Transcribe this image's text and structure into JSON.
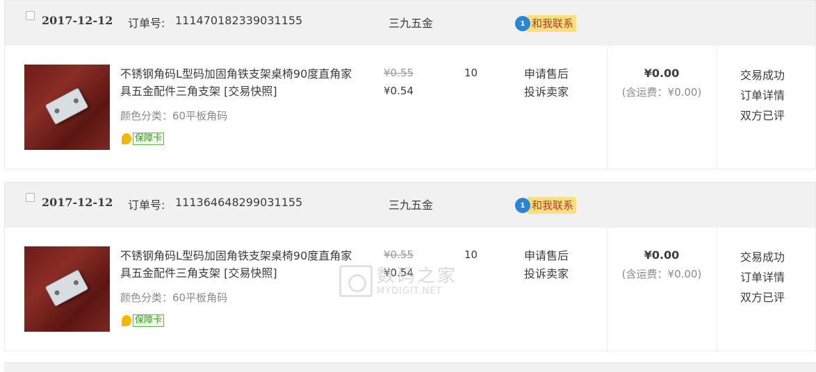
{
  "orders": [
    {
      "date": "2017-12-12",
      "order_no_label": "订单号:",
      "order_no": "111470182339031155",
      "shop": "三九五金",
      "contact_badge": "1",
      "contact_label": "和我联系",
      "item": {
        "title": "不锈钢角码L型码加固角铁支架桌椅90度直角家具五金配件三角支架 [交易快照]",
        "variant": "颜色分类：60平板角码",
        "guarantee": "保障卡",
        "price_original": "¥0.55",
        "price_current": "¥0.54",
        "quantity": "10",
        "after_sale": "申请售后",
        "complain": "投诉卖家"
      },
      "total": "¥0.00",
      "shipping": "(含运费：¥0.00)",
      "status": "交易成功",
      "detail_link": "订单详情",
      "review_status": "双方已评"
    },
    {
      "date": "2017-12-12",
      "order_no_label": "订单号:",
      "order_no": "111364648299031155",
      "shop": "三九五金",
      "contact_badge": "1",
      "contact_label": "和我联系",
      "item": {
        "title": "不锈钢角码L型码加固角铁支架桌椅90度直角家具五金配件三角支架 [交易快照]",
        "variant": "颜色分类：60平板角码",
        "guarantee": "保障卡",
        "price_original": "¥0.55",
        "price_current": "¥0.54",
        "quantity": "10",
        "after_sale": "申请售后",
        "complain": "投诉卖家"
      },
      "total": "¥0.00",
      "shipping": "(含运费：¥0.00)",
      "status": "交易成功",
      "detail_link": "订单详情",
      "review_status": "双方已评"
    }
  ],
  "watermark": {
    "cn": "数码之家",
    "en": "MYDIGIT.NET"
  },
  "colors": {
    "header_bg": "#f1f1f1",
    "contact_bubble": "#2a86d5",
    "contact_bg": "#f8e07e",
    "guarantee_green": "#3b9d2a"
  }
}
